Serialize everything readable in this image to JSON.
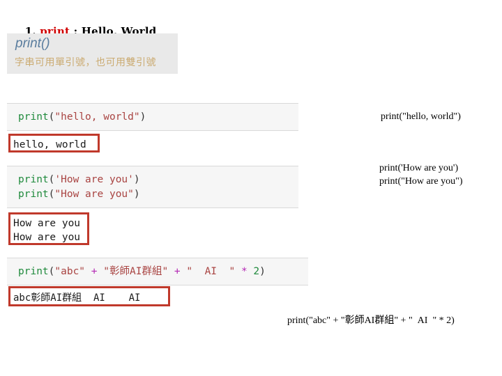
{
  "slide": {
    "title": {
      "number": "1.",
      "keyword": "print",
      "rest": " : Hello, World"
    },
    "header_box": {
      "heading": "print()",
      "subtitle": "字串可用單引號，也可用雙引號"
    },
    "code_blocks": [
      {
        "id": "block-1",
        "lines": [
          {
            "tokens": [
              {
                "text": "print",
                "type": "fn"
              },
              {
                "text": "(",
                "type": "par"
              },
              {
                "text": "\"hello, world\"",
                "type": "str"
              },
              {
                "text": ")",
                "type": "par"
              }
            ]
          }
        ],
        "output_lines": [
          "hello, world"
        ],
        "annotation": "print(\"hello, world\")"
      },
      {
        "id": "block-2",
        "lines": [
          {
            "tokens": [
              {
                "text": "print",
                "type": "fn"
              },
              {
                "text": "(",
                "type": "par"
              },
              {
                "text": "'How are you'",
                "type": "str"
              },
              {
                "text": ")",
                "type": "par"
              }
            ]
          },
          {
            "tokens": [
              {
                "text": "print",
                "type": "fn"
              },
              {
                "text": "(",
                "type": "par"
              },
              {
                "text": "\"How are you\"",
                "type": "str"
              },
              {
                "text": ")",
                "type": "par"
              }
            ]
          }
        ],
        "output_lines": [
          "How are you",
          "How are you"
        ],
        "annotation": "print('How are you')\nprint(\"How are you\")"
      },
      {
        "id": "block-3",
        "lines": [
          {
            "tokens": [
              {
                "text": "print",
                "type": "fn"
              },
              {
                "text": "(",
                "type": "par"
              },
              {
                "text": "\"abc\"",
                "type": "str"
              },
              {
                "text": " + ",
                "type": "op"
              },
              {
                "text": "\"彰師AI群組\"",
                "type": "str"
              },
              {
                "text": " + ",
                "type": "op"
              },
              {
                "text": "\"  AI  \"",
                "type": "str"
              },
              {
                "text": " * ",
                "type": "op"
              },
              {
                "text": "2",
                "type": "num"
              },
              {
                "text": ")",
                "type": "par"
              }
            ]
          }
        ],
        "output_lines": [
          "abc彰師AI群組  AI    AI "
        ],
        "annotation": "print(\"abc\" + \"彰師AI群組\" + \"  AI  \" * 2)"
      }
    ],
    "colors": {
      "keyword_red": "#d00000",
      "code_function_green": "#1f8a3c",
      "code_string_red": "#a94442",
      "code_operator_purple": "#b429b4",
      "output_border_red": "#c0392b",
      "header_heading_blue": "#5a7d9e",
      "header_subtitle_gold": "#cbab72",
      "code_background": "#f6f6f6",
      "header_background": "#e9e9e9"
    }
  }
}
